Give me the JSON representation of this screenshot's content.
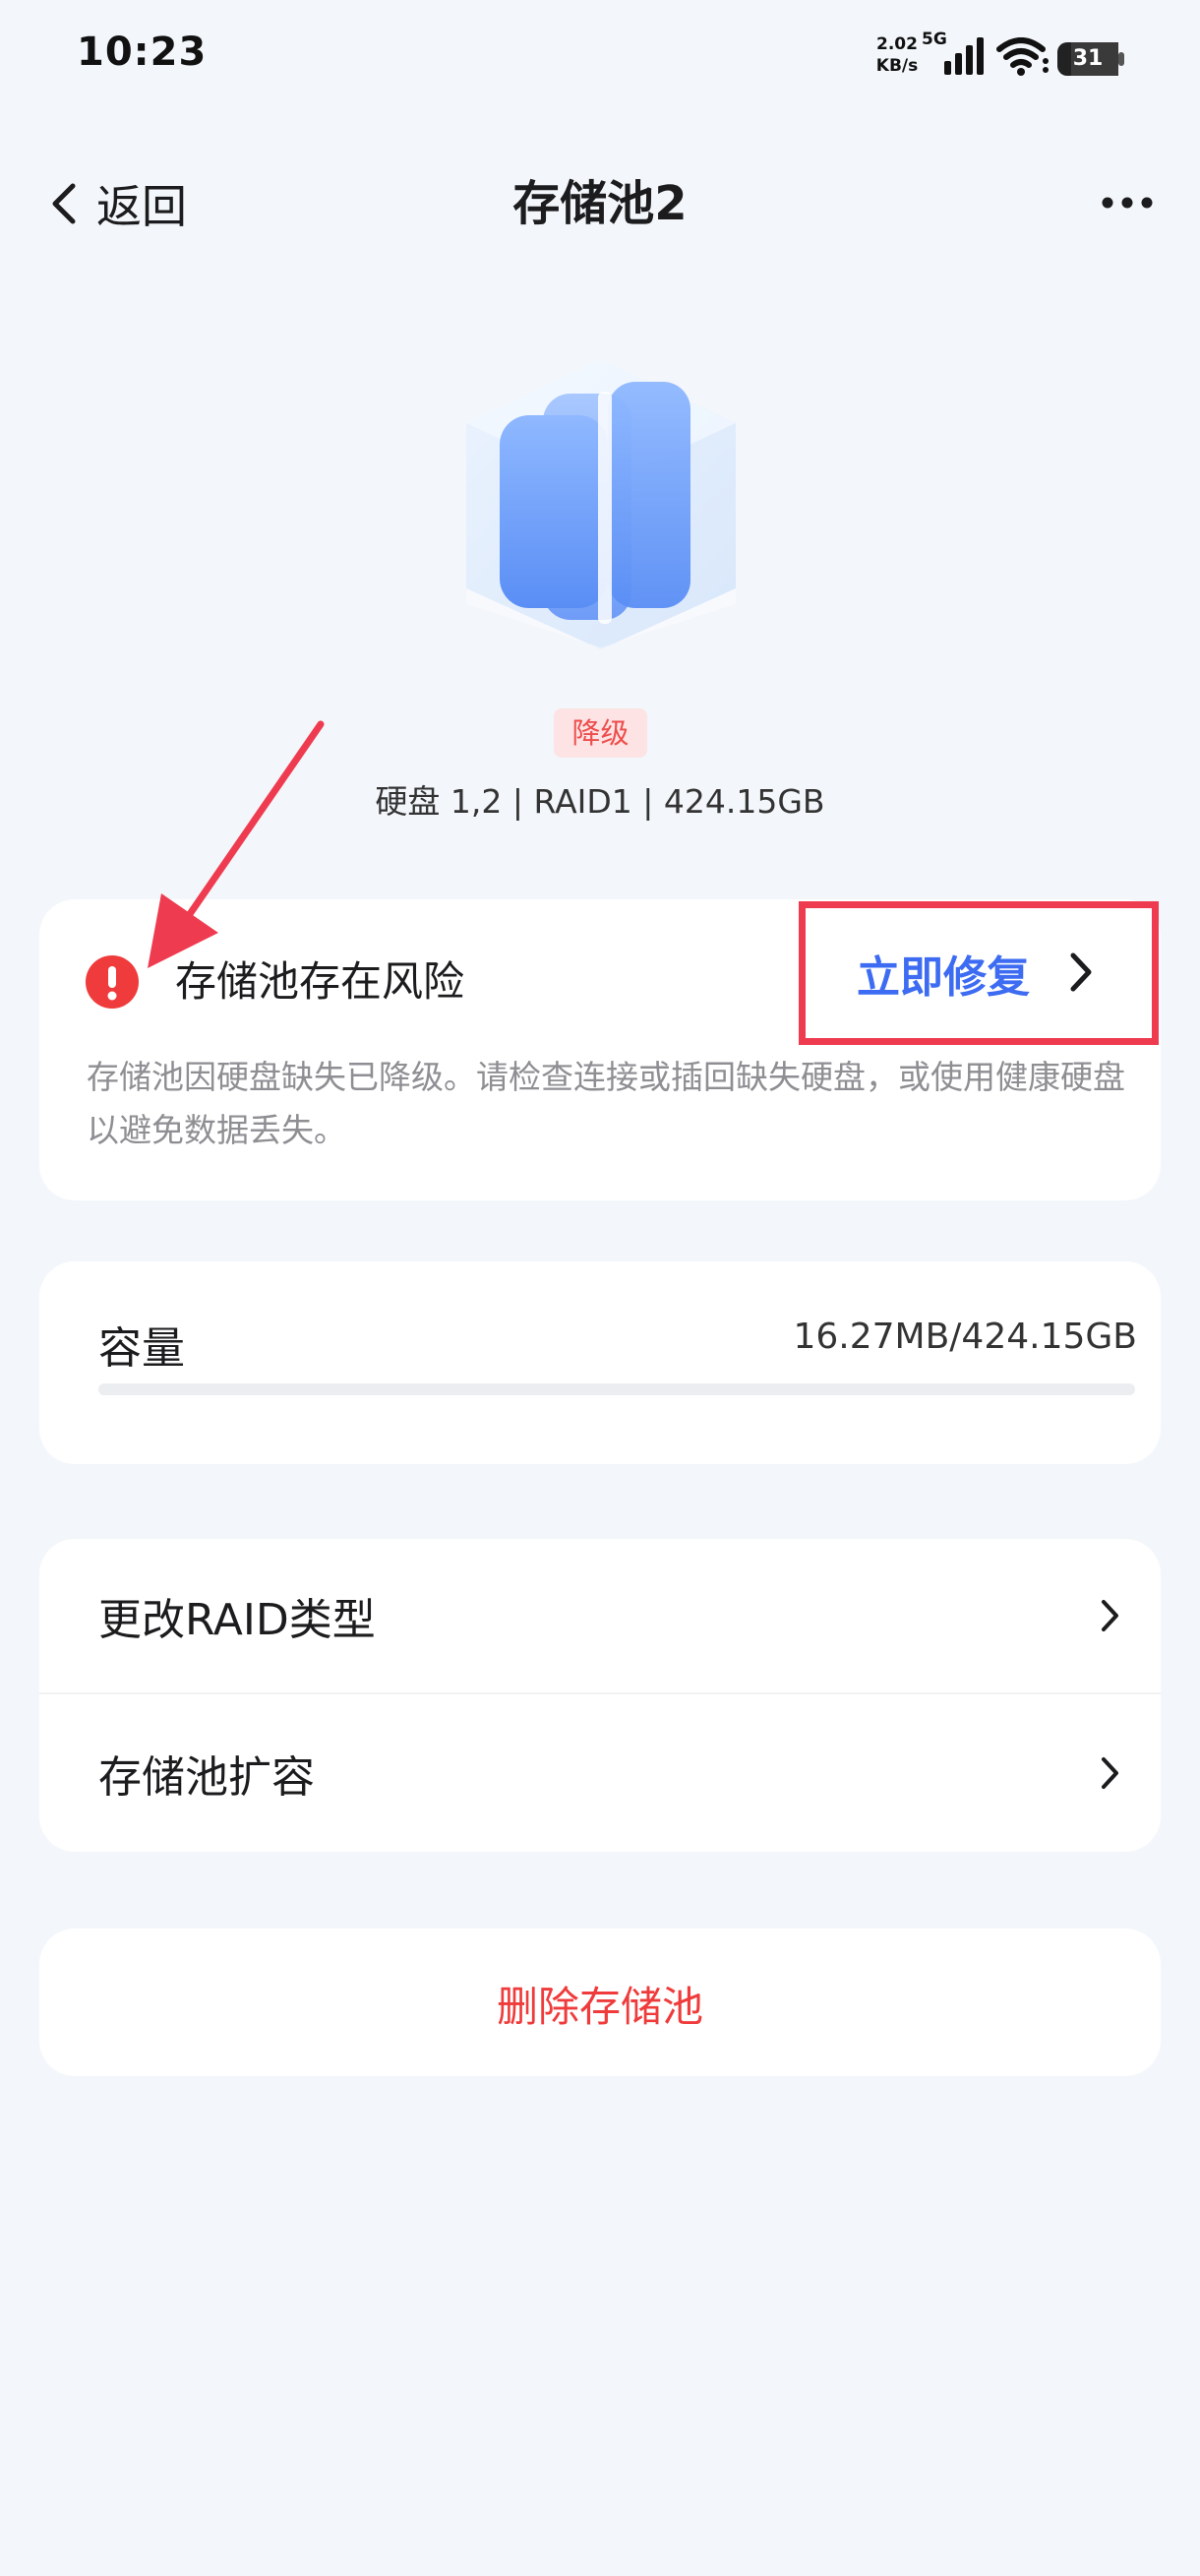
{
  "status_bar": {
    "time": "10:23",
    "net_speed_value": "2.02",
    "net_speed_unit": "KB/s",
    "network_type": "5G",
    "battery_level": "31",
    "icons": [
      "signal-icon",
      "wifi-icon",
      "battery-icon"
    ]
  },
  "nav": {
    "back_label": "返回",
    "title": "存储池2",
    "icons": [
      "back-chevron-icon",
      "more-icon"
    ]
  },
  "pool": {
    "status_badge": "降级",
    "summary": "硬盘 1,2 | RAID1 | 424.15GB",
    "icon": "storage-pool-icon"
  },
  "risk_card": {
    "title": "存储池存在风险",
    "description": "存储池因硬盘缺失已降级。请检查连接或插回缺失硬盘，或使用健康硬盘以避免数据丢失。",
    "repair_label": "立即修复",
    "icon": "warning-icon"
  },
  "capacity_card": {
    "label": "容量",
    "value": "16.27MB/424.15GB",
    "used_fraction": 3.84e-05
  },
  "actions": {
    "change_raid_label": "更改RAID类型",
    "expand_label": "存储池扩容"
  },
  "delete_label": "删除存储池",
  "colors": {
    "background": "#f3f6fa",
    "accent_blue": "#3d6cf2",
    "danger_red": "#ef3b3b",
    "badge_bg": "#fde3e3",
    "annotation_red": "#ef3b4f"
  }
}
